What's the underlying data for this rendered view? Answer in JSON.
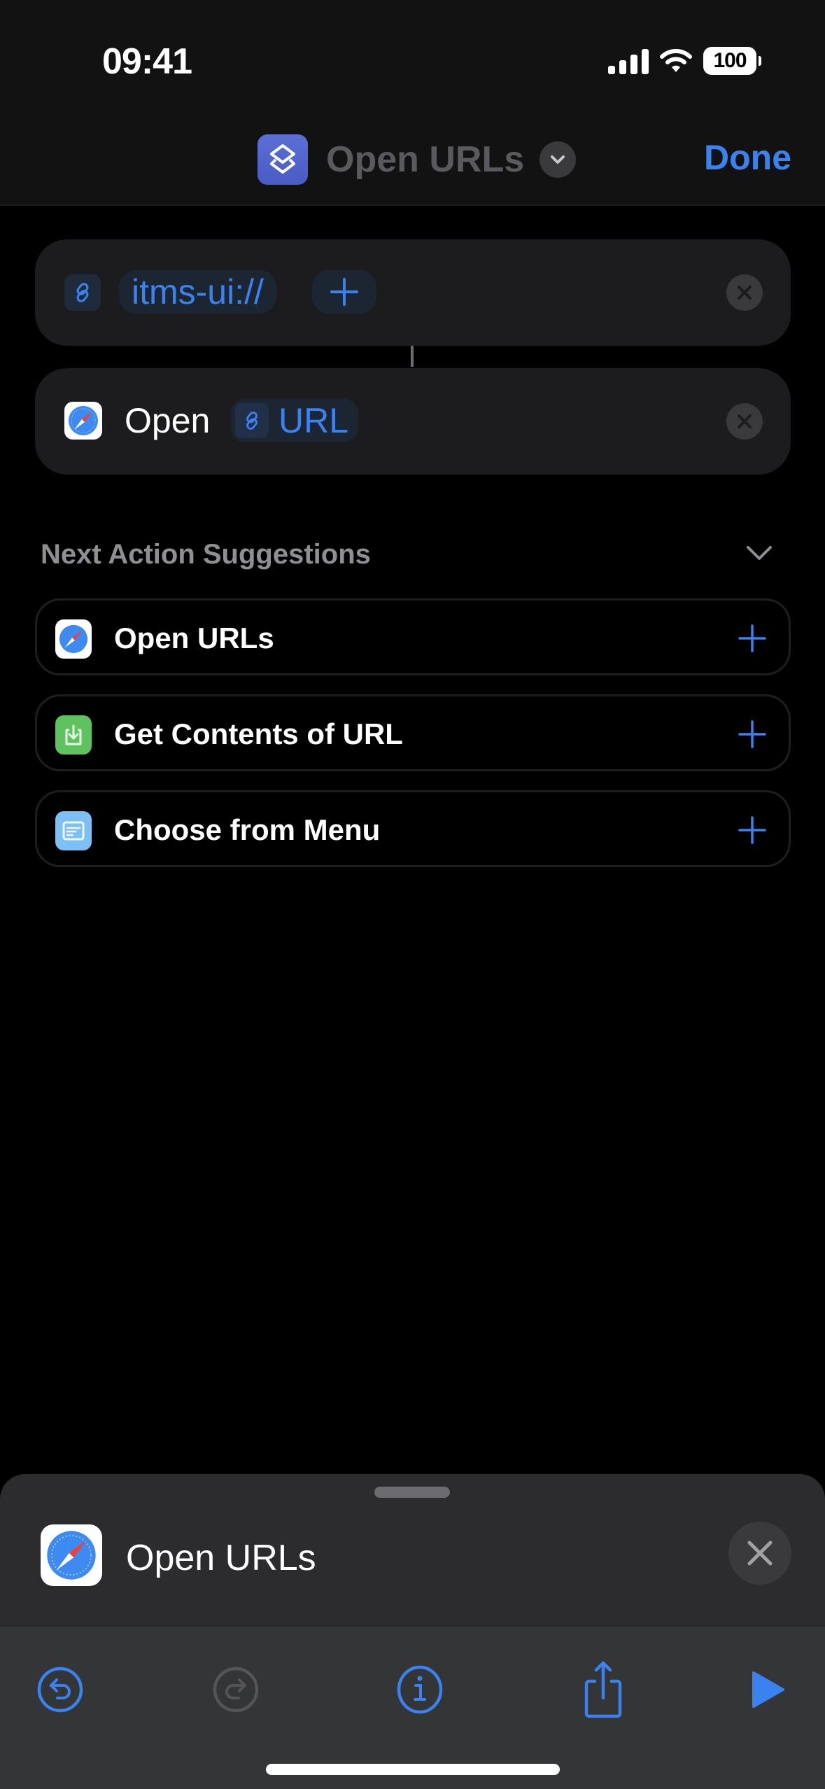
{
  "status_bar": {
    "time": "09:41",
    "battery": "100",
    "icons": [
      "cellular-signal-icon",
      "wifi-icon",
      "battery-icon"
    ]
  },
  "nav": {
    "app_icon": "shortcuts-icon",
    "title": "Open URLs",
    "title_menu_icon": "chevron-down-icon",
    "done_label": "Done"
  },
  "actions": [
    {
      "type": "URL",
      "icon": "link-icon",
      "value": "itms-ui://",
      "add_variable_label": "+",
      "remove_icon": "close-icon"
    },
    {
      "type": "Open URLs",
      "icon": "safari-icon",
      "verb": "Open",
      "parameter_icon": "link-icon",
      "parameter": "URL",
      "remove_icon": "close-icon"
    }
  ],
  "suggestions": {
    "header": "Next Action Suggestions",
    "collapse_icon": "chevron-down-icon",
    "items": [
      {
        "label": "Open URLs",
        "icon": "safari-icon",
        "icon_color": "#ffffff"
      },
      {
        "label": "Get Contents of URL",
        "icon": "download-icon",
        "icon_color": "#5ec35e"
      },
      {
        "label": "Choose from Menu",
        "icon": "menu-icon",
        "icon_color": "#7cc0f5"
      }
    ],
    "add_icon": "plus-icon"
  },
  "bottom_sheet": {
    "icon": "safari-icon",
    "title": "Open URLs",
    "close_icon": "close-icon"
  },
  "toolbar": {
    "buttons": [
      {
        "name": "undo",
        "icon": "undo-icon",
        "enabled": true
      },
      {
        "name": "redo",
        "icon": "redo-icon",
        "enabled": false
      },
      {
        "name": "info",
        "icon": "info-icon",
        "enabled": true
      },
      {
        "name": "share",
        "icon": "share-icon",
        "enabled": true
      },
      {
        "name": "run",
        "icon": "play-icon",
        "enabled": true
      }
    ]
  },
  "colors": {
    "accent": "#3a82f0",
    "background": "#000000",
    "card": "#1c1c1e",
    "sheet": "#2c2c2e",
    "toolbar": "#343537",
    "disabled": "#555558"
  }
}
